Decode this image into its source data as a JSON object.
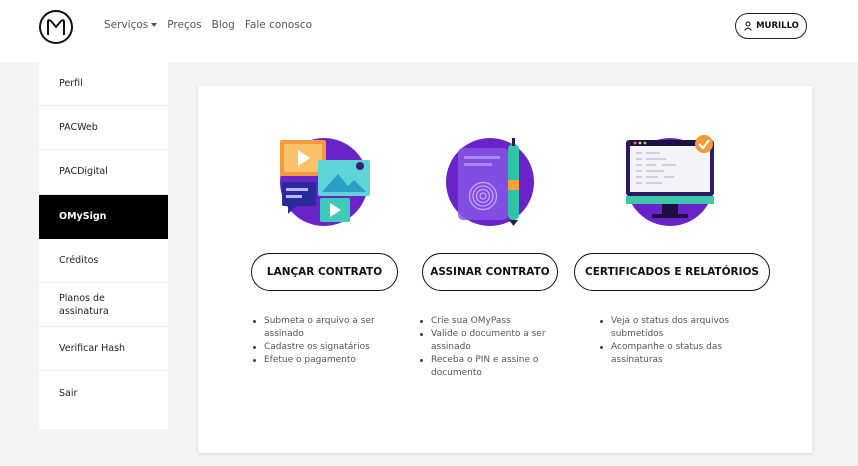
{
  "nav": {
    "servicos": "Serviços",
    "precos": "Preços",
    "blog": "Blog",
    "contato": "Fale conosco"
  },
  "user": {
    "name": "MURILLO",
    "icon": "user-icon"
  },
  "sidebar": {
    "items": [
      {
        "label": "Perfil"
      },
      {
        "label": "PACWeb"
      },
      {
        "label": "PACDigital"
      },
      {
        "label": "OMySign",
        "active": true
      },
      {
        "label": "Créditos"
      },
      {
        "label": "Planos de assinatura"
      },
      {
        "label": "Verificar Hash"
      },
      {
        "label": "Sair"
      }
    ]
  },
  "services": [
    {
      "button": "LANÇAR CONTRATO",
      "illustration": "media-files-icon",
      "bullets": [
        "Submeta o arquivo a ser assinado",
        "Cadastre os signatários",
        "Efetue o pagamento"
      ]
    },
    {
      "button": "ASSINAR CONTRATO",
      "illustration": "fingerprint-phone-icon",
      "bullets": [
        "Crie sua OMyPass",
        "Valide o documento a ser assinado",
        "Receba o PIN e assine o documento"
      ]
    },
    {
      "button": "CERTIFICADOS E RELATÓRIOS",
      "illustration": "monitor-check-icon",
      "bullets": [
        "Veja o status dos arquivos submetidos",
        "Acompanhe o status das assinaturas"
      ]
    }
  ],
  "colors": {
    "accent_purple": "#6a22c9",
    "active_bg": "#000000",
    "check_orange": "#f39a3a"
  }
}
